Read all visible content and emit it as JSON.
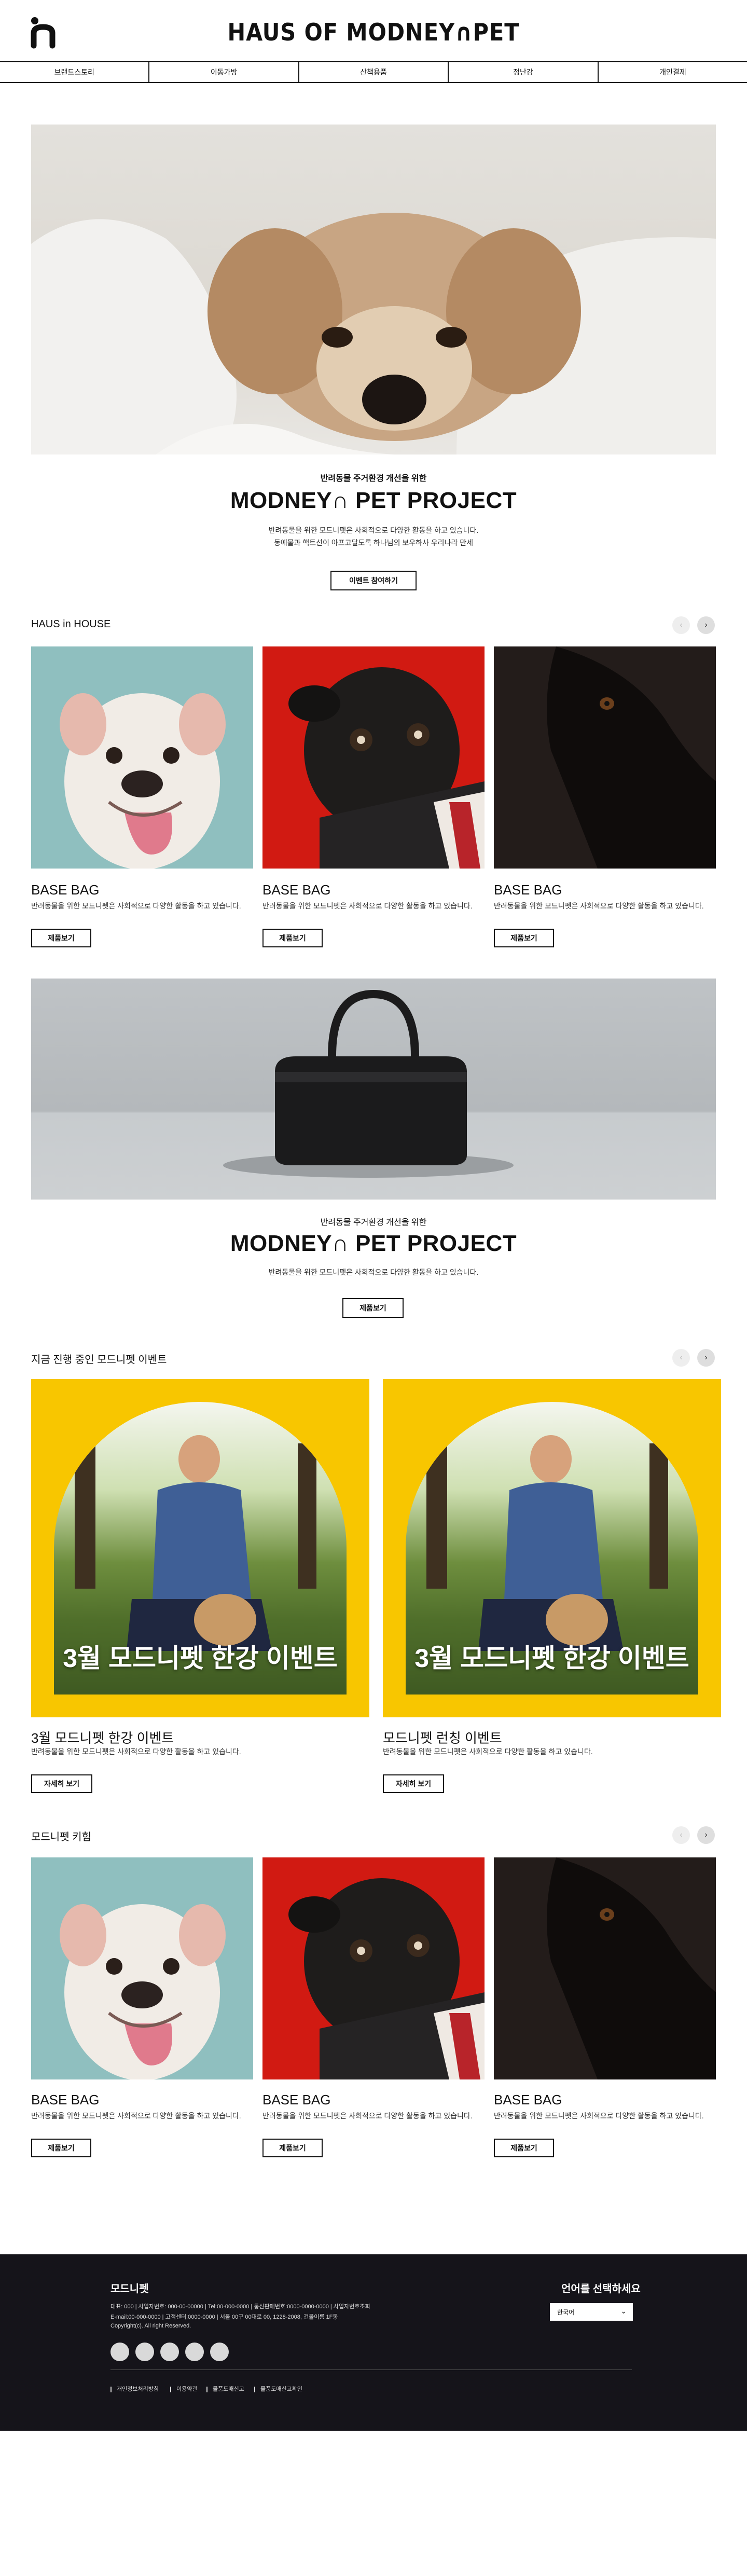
{
  "header": {
    "brand": "HAUS OF MODNEY∩PET",
    "logo_icon": "modney-pet-logo"
  },
  "nav": {
    "items": [
      {
        "label": "브랜드스토리"
      },
      {
        "label": "이동가방"
      },
      {
        "label": "산책용품"
      },
      {
        "label": "정난감"
      },
      {
        "label": "개인결제"
      }
    ]
  },
  "hero": {
    "subtitle": "반려동물 주거환경 개선을 위한",
    "title": "MODNEY∩ PET PROJECT",
    "desc_line1": "반려동물을 위한 모드니펫은 사회적으로 다양한 활동을 하고 있습니다.",
    "desc_line2": "동예물과 핵트선이 아프고달도록 하나님의 보우하사 우리나라 만세",
    "button": "이벤트 참여하기"
  },
  "haus_in_house": {
    "title": "HAUS in HOUSE",
    "cards": [
      {
        "title": "BASE BAG",
        "desc": "반려동물을 위한 모드니펫은 사회적으로 다양한 활동을 하고 있습니다.",
        "button": "제품보기",
        "image": "bulldog-photo"
      },
      {
        "title": "BASE BAG",
        "desc": "반려동물을 위한 모드니펫은 사회적으로 다양한 활동을 하고 있습니다.",
        "button": "제품보기",
        "image": "pug-photo"
      },
      {
        "title": "BASE BAG",
        "desc": "반려동물을 위한 모드니펫은 사회적으로 다양한 활동을 하고 있습니다.",
        "button": "제품보기",
        "image": "black-dog-photo"
      }
    ]
  },
  "project2": {
    "subtitle": "반려동물 주거환경 개선을 위한",
    "title": "MODNEY∩ PET PROJECT",
    "desc": "반려동물을 위한 모드니펫은 사회적으로 다양한 활동을 하고 있습니다.",
    "button": "제품보기"
  },
  "events": {
    "title": "지금 진행 중인 모드니펫 이벤트",
    "cards": [
      {
        "overlay": "3월 모드니펫 한강 이벤트",
        "title": "3월 모드니펫 한강 이벤트",
        "desc": "반려동물을 위한 모드니펫은 사회적으로 다양한 활동을 하고 있습니다.",
        "button": "자세히 보기"
      },
      {
        "overlay": "3월 모드니펫 한강 이벤트",
        "title": "모드니펫 런칭 이벤트",
        "desc": "반려동물을 위한 모드니펫은 사회적으로 다양한 활동을 하고 있습니다.",
        "button": "자세히 보기"
      }
    ]
  },
  "kids": {
    "title": "모드니펫 키힘",
    "cards": [
      {
        "title": "BASE BAG",
        "desc": "반려동물을 위한 모드니펫은 사회적으로 다양한 활동을 하고 있습니다.",
        "button": "제품보기",
        "image": "bulldog-photo"
      },
      {
        "title": "BASE BAG",
        "desc": "반려동물을 위한 모드니펫은 사회적으로 다양한 활동을 하고 있습니다.",
        "button": "제품보기",
        "image": "pug-photo"
      },
      {
        "title": "BASE BAG",
        "desc": "반려동물을 위한 모드니펫은 사회적으로 다양한 활동을 하고 있습니다.",
        "button": "제품보기",
        "image": "black-dog-photo"
      }
    ]
  },
  "footer": {
    "company": "모드니펫",
    "info_line1": "대표: 000  |  사업자번호: 000-00-00000  |  Tel:00-000-0000  |  통신판매번호:0000-0000-0000  |  사업자번호조회",
    "info_line2": "E-mail:00-000-0000  |  고객센터:0000-0000  |  서울 00구 00대로 00, 1228-2008, 건물이름 1F동",
    "copyright": "Copyright(c). All right Reserved.",
    "links": [
      "개인정보처리방침",
      "이용약관",
      "물품도매신고",
      "물품도매신고확인"
    ],
    "lang_title": "언어를 선택하세요",
    "lang_selected": "한국어",
    "social_icons": [
      "social-icon-1",
      "social-icon-2",
      "social-icon-3",
      "social-icon-4",
      "social-icon-5"
    ]
  },
  "colors": {
    "accent_yellow": "#f8c600",
    "footer_bg": "#15141a"
  }
}
